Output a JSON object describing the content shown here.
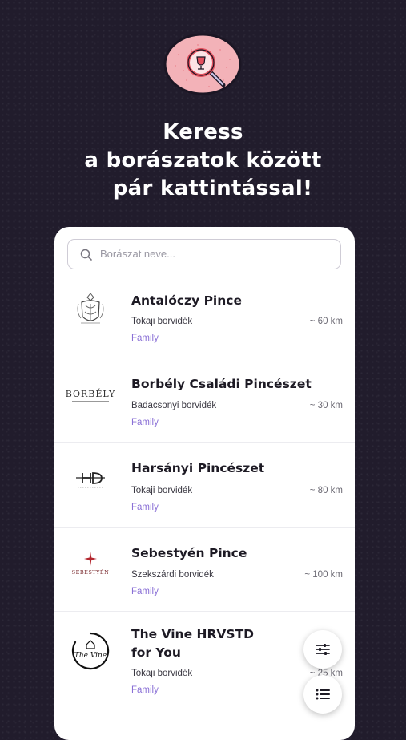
{
  "headline": {
    "line1": "Keress",
    "line2": "a borászatok között",
    "line3": "pár kattintással!"
  },
  "search": {
    "placeholder": "Borászat neve..."
  },
  "wineries": [
    {
      "name_line1": "Antalóczy Pince",
      "name_line2": "",
      "region": "Tokaji borvidék",
      "distance": "~ 60 km",
      "tag": "Family",
      "logo": "crest-logo"
    },
    {
      "name_line1": "Borbély Családi Pincészet",
      "name_line2": "",
      "region": "Badacsonyi borvidék",
      "distance": "~ 30 km",
      "tag": "Family",
      "logo": "borbely-logo",
      "logo_text": "BORBÉLY"
    },
    {
      "name_line1": "Harsányi Pincészet",
      "name_line2": "",
      "region": "Tokaji borvidék",
      "distance": "~ 80 km",
      "tag": "Family",
      "logo": "hd-logo",
      "logo_text": "HD"
    },
    {
      "name_line1": "Sebestyén Pince",
      "name_line2": "",
      "region": "Szekszárdi borvidék",
      "distance": "~ 100 km",
      "tag": "Family",
      "logo": "sebestyen-logo",
      "logo_text": "SEBESTYÉN"
    },
    {
      "name_line1": "The Vine HRVSTD",
      "name_line2": "for You",
      "region": "Tokaji borvidék",
      "distance": "~ 25 km",
      "tag": "Family",
      "logo": "the-vine-logo",
      "logo_text": "The Vine"
    }
  ],
  "colors": {
    "background": "#211c2c",
    "accent_tag": "#8a70d6",
    "badge_pink": "#f3b2b8",
    "badge_red": "#e2505e"
  },
  "icons": {
    "hero": "wine-search-badge-icon",
    "search": "search-icon",
    "filter_fab": "sliders-icon",
    "list_fab": "list-icon"
  }
}
